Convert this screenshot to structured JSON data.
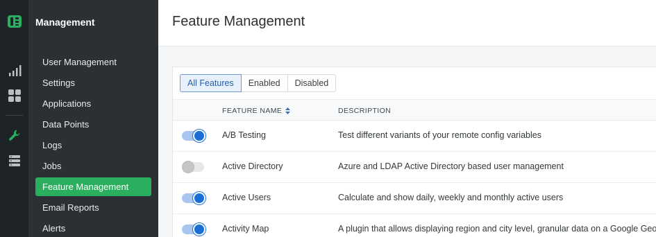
{
  "rail": {
    "icons": [
      "logo-icon",
      "analytics-icon",
      "dashboard-grid-icon",
      "wrench-icon",
      "database-icon"
    ]
  },
  "sidebar": {
    "title": "Management",
    "items": [
      {
        "label": "User Management"
      },
      {
        "label": "Settings"
      },
      {
        "label": "Applications"
      },
      {
        "label": "Data Points"
      },
      {
        "label": "Logs"
      },
      {
        "label": "Jobs"
      },
      {
        "label": "Feature Management",
        "active": true
      },
      {
        "label": "Email Reports"
      },
      {
        "label": "Alerts"
      }
    ]
  },
  "page": {
    "title": "Feature Management"
  },
  "filters": {
    "tabs": [
      {
        "label": "All Features",
        "active": true
      },
      {
        "label": "Enabled"
      },
      {
        "label": "Disabled"
      }
    ]
  },
  "table": {
    "columns": {
      "name": "FEATURE NAME",
      "description": "DESCRIPTION"
    },
    "rows": [
      {
        "enabled": true,
        "name": "A/B Testing",
        "description": "Test different variants of your remote config variables"
      },
      {
        "enabled": false,
        "name": "Active Directory",
        "description": "Azure and LDAP Active Directory based user management"
      },
      {
        "enabled": true,
        "name": "Active Users",
        "description": "Calculate and show daily, weekly and monthly active users"
      },
      {
        "enabled": true,
        "name": "Activity Map",
        "description": "A plugin that allows displaying region and city level, granular data on a Google Geo"
      }
    ]
  },
  "colors": {
    "accent_green": "#2aaf5e",
    "toggle_on": "#1a6fd6",
    "rail_bg": "#1e2326",
    "sidebar_bg": "#2a3033"
  }
}
